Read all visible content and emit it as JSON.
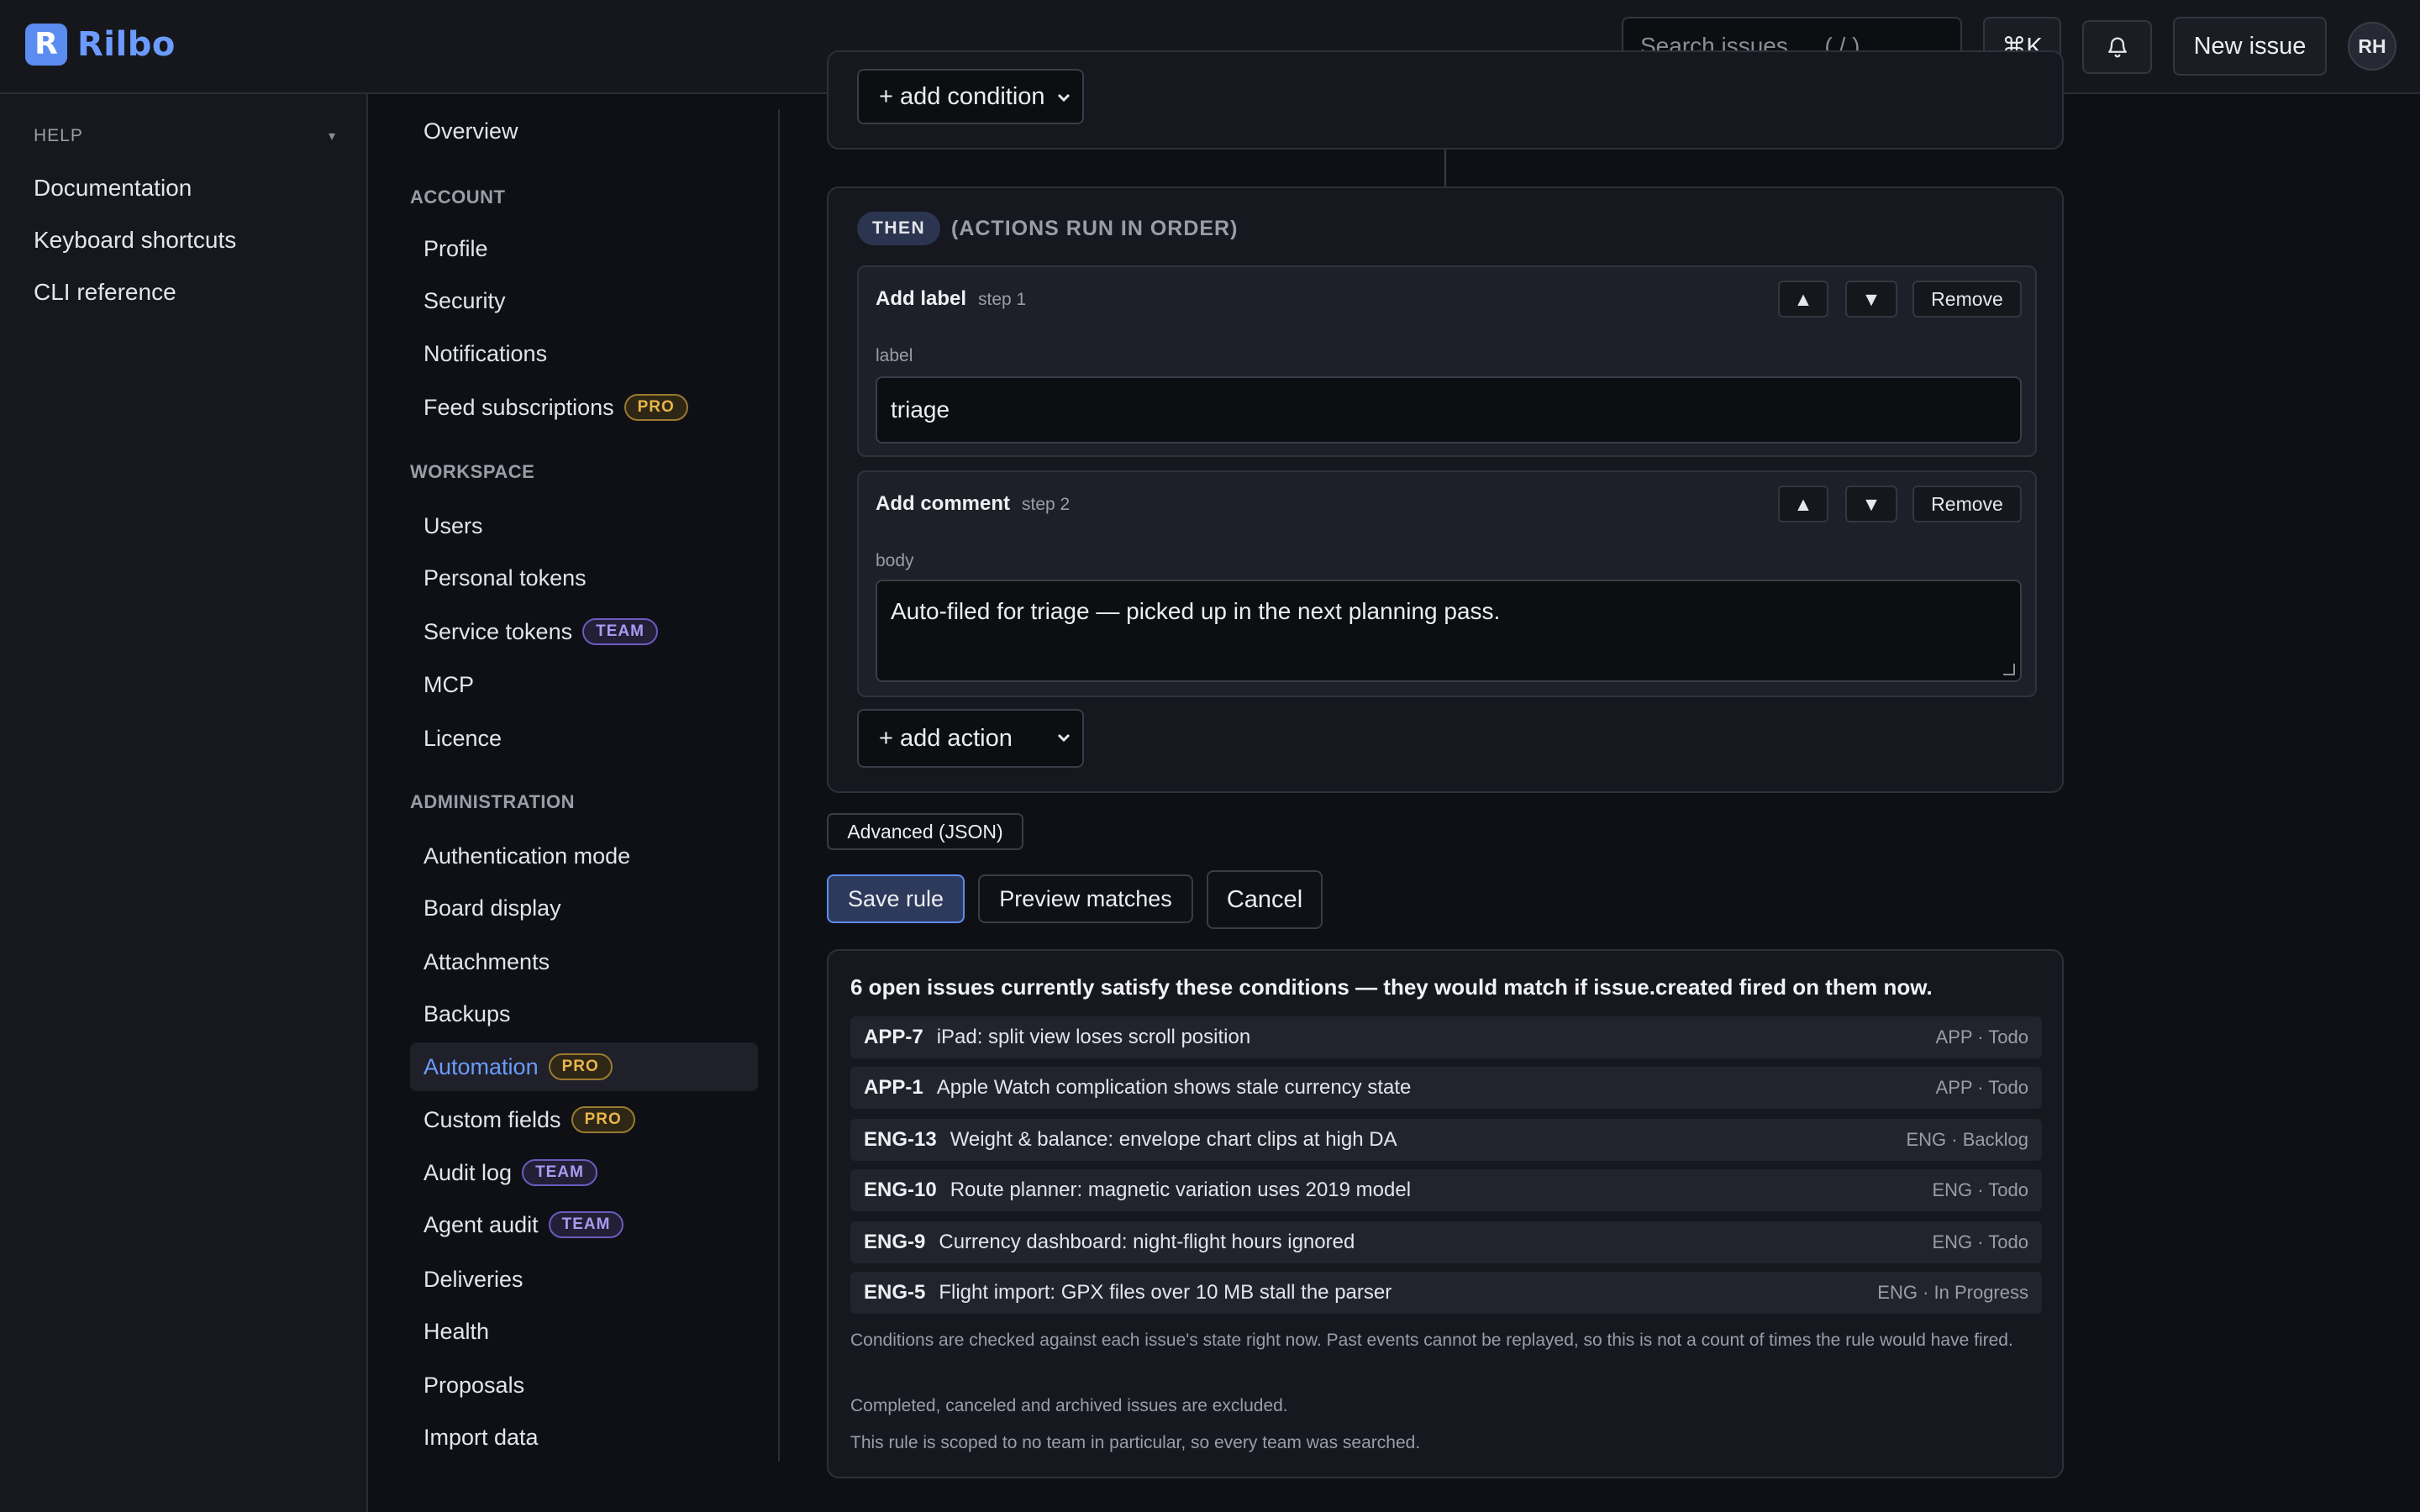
{
  "app": {
    "logo_letter": "R",
    "name": "Rilbo"
  },
  "topbar": {
    "search_placeholder": "Search issues…  ( / )",
    "kbd_label": "⌘K",
    "new_issue_label": "New issue",
    "avatar_initials": "RH"
  },
  "help": {
    "heading": "HELP",
    "caret": "▾",
    "links": [
      "Documentation",
      "Keyboard shortcuts",
      "CLI reference"
    ]
  },
  "nav": {
    "overview": "Overview",
    "sections": {
      "account": "ACCOUNT",
      "workspace": "WORKSPACE",
      "administration": "ADMINISTRATION"
    },
    "items": {
      "profile": "Profile",
      "security": "Security",
      "notifications": "Notifications",
      "feed_subscriptions": "Feed subscriptions",
      "users": "Users",
      "personal_tokens": "Personal tokens",
      "service_tokens": "Service tokens",
      "mcp": "MCP",
      "licence": "Licence",
      "authentication_mode": "Authentication mode",
      "board_display": "Board display",
      "attachments": "Attachments",
      "backups": "Backups",
      "automation": "Automation",
      "custom_fields": "Custom fields",
      "audit_log": "Audit log",
      "agent_audit": "Agent audit",
      "deliveries": "Deliveries",
      "health": "Health",
      "proposals": "Proposals",
      "import_data": "Import data"
    },
    "badges": {
      "pro": "PRO",
      "team": "TEAM"
    }
  },
  "rule": {
    "add_condition_label": "+ add condition",
    "then_label": "THEN",
    "then_note": "(ACTIONS RUN IN ORDER)",
    "steps": [
      {
        "title": "Add label",
        "step": "step 1",
        "field_label": "label",
        "value": "triage"
      },
      {
        "title": "Add comment",
        "step": "step 2",
        "field_label": "body",
        "value": "Auto-filed for triage — picked up in the next planning pass."
      }
    ],
    "move_up": "▲",
    "move_down": "▼",
    "remove_label": "Remove",
    "add_action_label": "+ add action",
    "advanced_label": "Advanced (JSON)",
    "save_label": "Save rule",
    "preview_label": "Preview matches",
    "cancel_label": "Cancel"
  },
  "preview": {
    "summary": "6 open issues currently satisfy these conditions — they would match if issue.created fired on them now.",
    "issues": [
      {
        "key": "APP-7",
        "title": "iPad: split view loses scroll position",
        "meta": "APP · Todo"
      },
      {
        "key": "APP-1",
        "title": "Apple Watch complication shows stale currency state",
        "meta": "APP · Todo"
      },
      {
        "key": "ENG-13",
        "title": "Weight & balance: envelope chart clips at high DA",
        "meta": "ENG · Backlog"
      },
      {
        "key": "ENG-10",
        "title": "Route planner: magnetic variation uses 2019 model",
        "meta": "ENG · Todo"
      },
      {
        "key": "ENG-9",
        "title": "Currency dashboard: night-flight hours ignored",
        "meta": "ENG · Todo"
      },
      {
        "key": "ENG-5",
        "title": "Flight import: GPX files over 10 MB stall the parser",
        "meta": "ENG · In Progress"
      }
    ],
    "notes": [
      "Conditions are checked against each issue's state right now. Past events cannot be replayed, so this is not a count of times the rule would have fired.",
      "Completed, canceled and archived issues are excluded.",
      "This rule is scoped to no team in particular, so every team was searched."
    ]
  },
  "colors": {
    "accent": "#6c9bff",
    "pro": "#e8b64a",
    "team": "#a99bf2",
    "background": "#0f1015"
  }
}
